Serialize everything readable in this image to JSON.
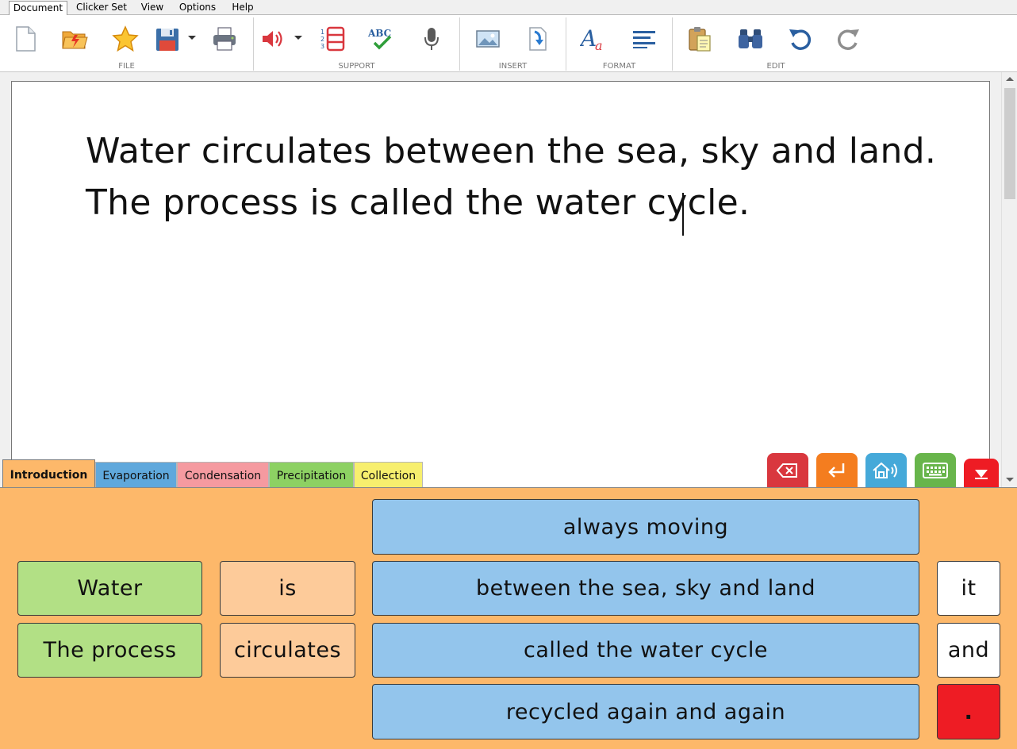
{
  "menu": {
    "items": [
      "Document",
      "Clicker Set",
      "View",
      "Options",
      "Help"
    ],
    "active": "Document"
  },
  "ribbon": {
    "groups": [
      {
        "label": "FILE",
        "icons": [
          "new-document-icon",
          "open-folder-icon",
          "favourite-star-icon",
          "save-disk-icon",
          "print-icon"
        ]
      },
      {
        "label": "SUPPORT",
        "icons": [
          "speech-volume-icon",
          "numbered-list-icon",
          "spellcheck-icon",
          "microphone-icon"
        ]
      },
      {
        "label": "INSERT",
        "icons": [
          "insert-picture-icon",
          "insert-file-icon"
        ]
      },
      {
        "label": "FORMAT",
        "icons": [
          "font-icon",
          "align-left-icon"
        ]
      },
      {
        "label": "EDIT",
        "icons": [
          "paste-clipboard-icon",
          "find-binoculars-icon",
          "undo-icon",
          "redo-icon"
        ]
      }
    ],
    "spell_icon_text": "ABC",
    "font_icon_text": "Aa"
  },
  "document": {
    "lines": [
      "Water circulates between the sea, sky and land.",
      "The process is called the water cycle."
    ]
  },
  "tabs": [
    {
      "label": "Introduction",
      "color": "#fdb86a",
      "active": true
    },
    {
      "label": "Evaporation",
      "color": "#5fa8dc",
      "active": false
    },
    {
      "label": "Condensation",
      "color": "#f59aa0",
      "active": false
    },
    {
      "label": "Precipitation",
      "color": "#8dd163",
      "active": false
    },
    {
      "label": "Collection",
      "color": "#f7ef6e",
      "active": false
    }
  ],
  "actions": [
    {
      "name": "backspace",
      "color": "#d9373e",
      "icon": "backspace-icon"
    },
    {
      "name": "enter",
      "color": "#f47d1f",
      "icon": "enter-icon"
    },
    {
      "name": "speak",
      "color": "#45a9d9",
      "icon": "speak-house-icon"
    },
    {
      "name": "keyboard",
      "color": "#68b54b",
      "icon": "keyboard-icon"
    },
    {
      "name": "collapse",
      "color": "#ee1c24",
      "icon": "collapse-arrow-icon"
    }
  ],
  "grid": {
    "col1": [
      "Water",
      "The process"
    ],
    "col2": [
      "is",
      "circulates"
    ],
    "col3": [
      "always moving",
      "between the sea, sky and land",
      "called the water cycle",
      "recycled again and again"
    ],
    "col4": [
      "it",
      "and",
      "."
    ]
  }
}
